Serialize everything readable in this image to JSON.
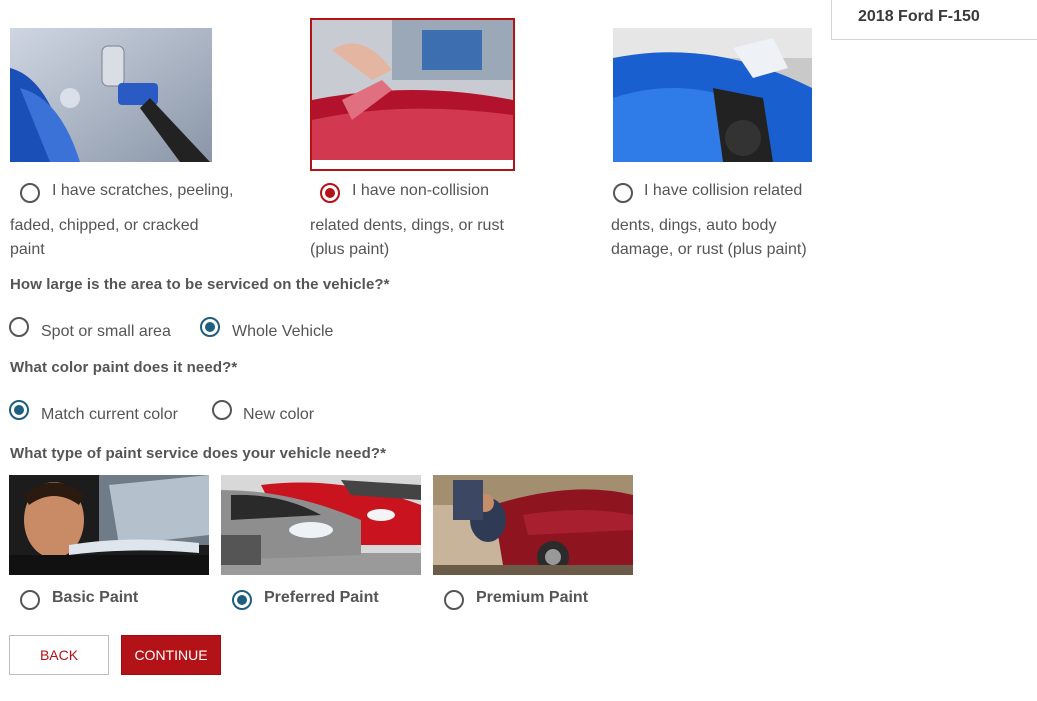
{
  "vehicle": {
    "name": "2018 Ford F-150"
  },
  "damage_options": [
    {
      "line1": "I have scratches, peeling,",
      "line2": "faded, chipped, or cracked",
      "line3": "paint",
      "selected": false
    },
    {
      "line1": "I have non-collision",
      "line2": "related dents, dings, or rust",
      "line3": "(plus paint)",
      "selected": true
    },
    {
      "line1": "I have collision related",
      "line2": "dents, dings, auto body",
      "line3": "damage, or rust (plus paint)",
      "selected": false
    }
  ],
  "area_question": {
    "label": "How large is the area to be serviced on the vehicle?*",
    "options": [
      {
        "label": "Spot or small area",
        "selected": false
      },
      {
        "label": "Whole Vehicle",
        "selected": true
      }
    ]
  },
  "color_question": {
    "label": "What color paint does it need?*",
    "options": [
      {
        "label": "Match current color",
        "selected": true
      },
      {
        "label": "New color",
        "selected": false
      }
    ]
  },
  "service_question": {
    "label": "What type of paint service does your vehicle need?*",
    "options": [
      {
        "label": "Basic Paint",
        "selected": false
      },
      {
        "label": "Preferred Paint",
        "selected": true
      },
      {
        "label": "Premium Paint",
        "selected": false
      }
    ]
  },
  "buttons": {
    "back": "BACK",
    "continue": "CONTINUE"
  },
  "colors": {
    "accent_red": "#b31217",
    "radio_blue": "#1e5e7e",
    "text": "#555555"
  }
}
